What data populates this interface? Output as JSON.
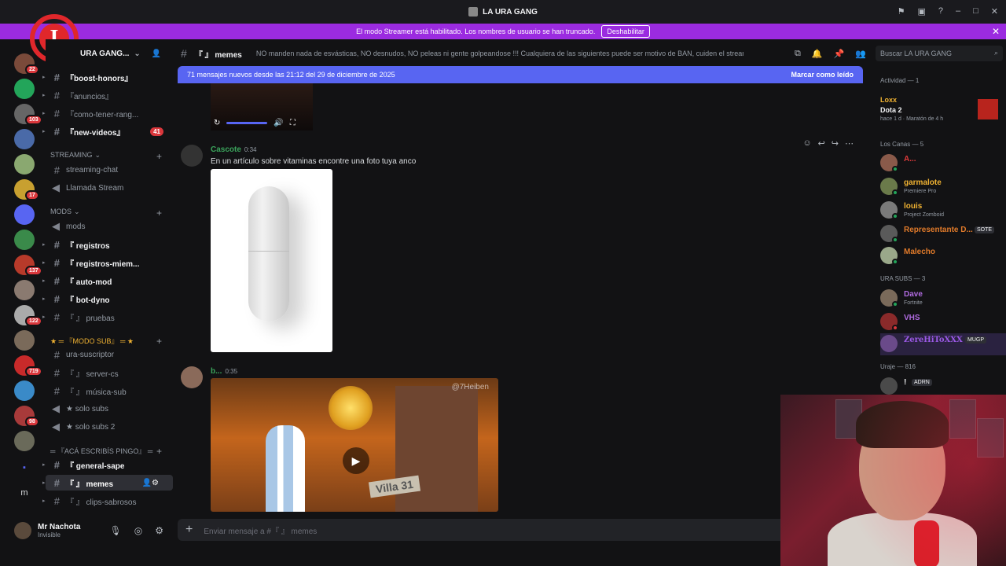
{
  "window": {
    "title": "LA URA GANG"
  },
  "streamer_banner": {
    "text": "El modo Streamer está habilitado. Los nombres de usuario se han truncado.",
    "button": "Deshabilitar"
  },
  "server": {
    "name": "URA GANG...",
    "logo_letter": "I"
  },
  "guild_badges": [
    "22",
    "103",
    "17",
    "137",
    "122",
    "719",
    "98"
  ],
  "channels": {
    "top": [
      {
        "name": "『boost-honors』",
        "bold": true
      },
      {
        "name": "『anuncios』",
        "bold": false
      },
      {
        "name": "『como-tener-rang...",
        "bold": false
      },
      {
        "name": "『new-videos』",
        "bold": true,
        "badge": "41"
      }
    ],
    "streaming_category": "STREAMING",
    "streaming": [
      {
        "name": "streaming-chat"
      },
      {
        "name": "Llamada Stream"
      }
    ],
    "mods_category": "mods",
    "mods": [
      {
        "name": "mods",
        "bold": false
      },
      {
        "name": "『 registros",
        "bold": true
      },
      {
        "name": "『 registros-miem...",
        "bold": true
      },
      {
        "name": "『 auto-mod",
        "bold": true
      },
      {
        "name": "『 bot-dyno",
        "bold": true
      },
      {
        "name": "『 』 pruebas",
        "bold": false
      }
    ],
    "sub_category": "★ ═ 『MODO SUB』 ═ ★",
    "sub": [
      {
        "name": "ura-suscriptor"
      },
      {
        "name": "『 』 server-cs"
      },
      {
        "name": "『 』 música-sub"
      },
      {
        "name": "★ solo subs"
      },
      {
        "name": "★ solo subs 2"
      }
    ],
    "general_category": "═ 『acá escribís pingo』 ═",
    "general": [
      {
        "name": "『 general-sape",
        "bold": true
      },
      {
        "name": "『 』 memes",
        "bold": true,
        "active": true
      },
      {
        "name": "『 』 clips-sabrosos",
        "bold": false
      }
    ]
  },
  "user": {
    "name": "Mr Nachota",
    "status": "Invisible"
  },
  "chat_header": {
    "channel": "『 』 memes",
    "topic": "NO manden nada de esvásticas, NO desnudos, NO peleas ni gente golpeandose !!! Cualquiera de las siguientes puede ser motivo de BAN, cuiden el stream!"
  },
  "search": {
    "placeholder": "Buscar LA URA GANG"
  },
  "new_messages": {
    "text": "71 mensajes nuevos desde las 21:12 del 29 de diciembre de 2025",
    "action": "Marcar como leído"
  },
  "messages": [
    {
      "author": "Cascote",
      "time": "0:34",
      "text": "En un artículo sobre vitaminas encontre una foto tuya anco",
      "author_color": "#3ba55c"
    },
    {
      "author": "b...",
      "time": "0:35",
      "text": "",
      "author_color": "#3ba55c",
      "gif_watermark": "@7Heiben",
      "gif_sign": "Villa 31"
    }
  ],
  "composer": {
    "placeholder": "Enviar mensaje a #『 』 memes"
  },
  "members": {
    "activity_header": "Actividad — 1",
    "activity": {
      "name": "Loxx",
      "game": "Dota 2",
      "time": "hace 1 d · Maratón de 4 h"
    },
    "groups": [
      {
        "title": "Los Canas — 5",
        "members": [
          {
            "name": "A...",
            "status": "",
            "color": "#e03a3a"
          },
          {
            "name": "garmalote",
            "status": "Premiere Pro",
            "color": "#f0b232"
          },
          {
            "name": "louis",
            "status": "Project Zomboid",
            "color": "#f0b232"
          },
          {
            "name": "Representante D...",
            "status": "",
            "color": "#e07a2a",
            "tag": "SOTE"
          },
          {
            "name": "Malecho",
            "status": "",
            "color": "#e07a2a"
          }
        ]
      },
      {
        "title": "URA SUBS — 3",
        "members": [
          {
            "name": "Dave",
            "status": "Fortnite",
            "color": "#b06be0"
          },
          {
            "name": "VHS",
            "status": "",
            "color": "#b06be0"
          },
          {
            "name": "ZereHiToXXX",
            "status": "",
            "color": "#9b59e6",
            "tag": "MUGP"
          }
        ]
      },
      {
        "title": "Uraje — 816",
        "members": [
          {
            "name": "!",
            "status": "",
            "color": "#f2f3f5",
            "tag": "ADRN"
          }
        ]
      }
    ]
  },
  "colors": {
    "accent": "#5865f2",
    "banner": "#9b2be0",
    "badge": "#da373c"
  }
}
